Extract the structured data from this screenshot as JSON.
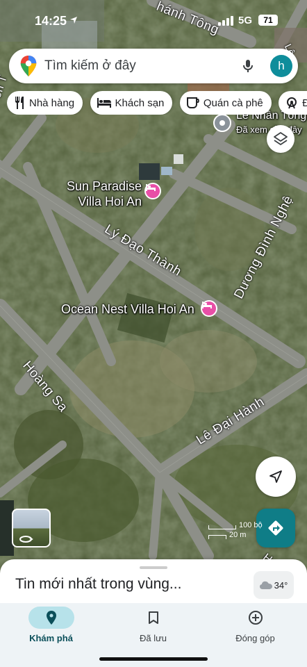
{
  "status_bar": {
    "time": "14:25",
    "network": "5G",
    "battery": "71"
  },
  "search": {
    "placeholder": "Tìm kiếm ở đây",
    "avatar_letter": "h"
  },
  "chips": [
    {
      "label": "Nhà hàng",
      "icon": "fork-knife-icon"
    },
    {
      "label": "Khách sạn",
      "icon": "bed-icon"
    },
    {
      "label": "Quán cà phê",
      "icon": "coffee-icon"
    },
    {
      "label": "Đị",
      "icon": "ferris-wheel-icon"
    }
  ],
  "map": {
    "street_labels": {
      "thanh_tong": "hánh Tông",
      "ly_dao_thanh": "Lý Đạo Thành",
      "duong_dinh_nghe": "Dương Đình Nghệ",
      "hoang_sa": "Hoàng Sa",
      "le_dai_hanh": "Lê Đại Hành",
      "hoang_sa_bottom": "Hoàng Sa",
      "left_edge_road": "ên T",
      "top_right_road": "Lê"
    },
    "places": {
      "sun_paradise": "Sun Paradise\nVilla Hoi An",
      "ocean_nest": "Ocean Nest Villa Hoi An",
      "le_nhan_tong_title": "Lê Nhân Tông",
      "le_nhan_tong_sub": "Đã xem gần đây"
    },
    "scale": {
      "top": "100 bộ",
      "bottom": "20 m"
    }
  },
  "sheet": {
    "title": "Tin mới nhất trong vùng...",
    "temperature": "34°"
  },
  "nav": [
    {
      "label": "Khám phá",
      "icon": "explore-pin-icon",
      "active": true
    },
    {
      "label": "Đã lưu",
      "icon": "bookmark-icon",
      "active": false
    },
    {
      "label": "Đóng góp",
      "icon": "add-circle-icon",
      "active": false
    }
  ],
  "colors": {
    "hotel_pin": "#e84fa7",
    "accent_teal": "#0f7d87",
    "avatar": "#0f8d9b",
    "nav_active_pill": "#b7e2ea"
  }
}
